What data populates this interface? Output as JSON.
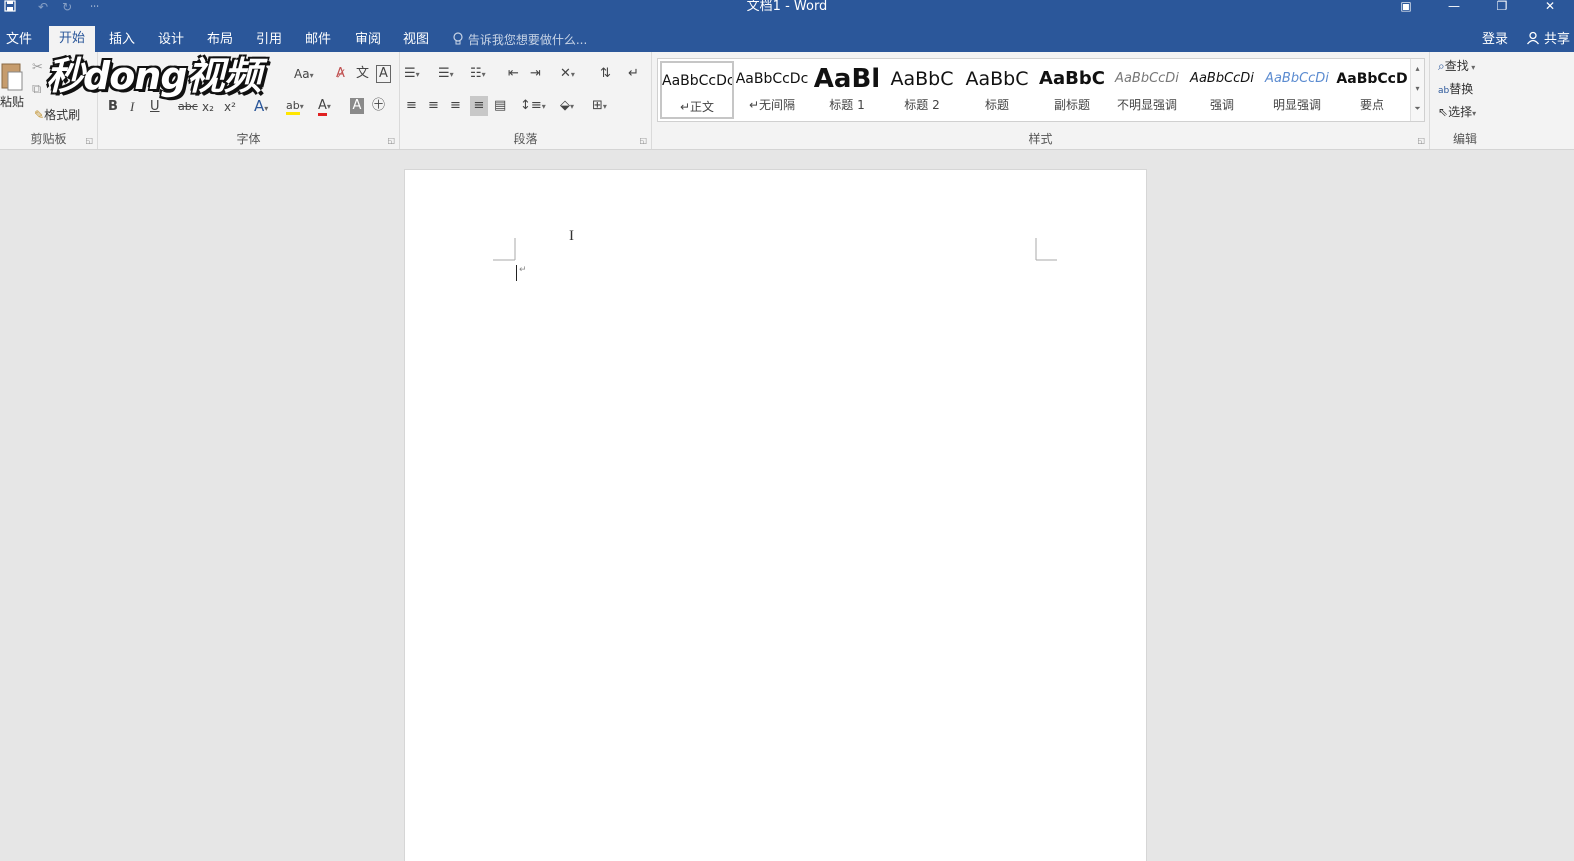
{
  "window": {
    "title": "文档1 - Word"
  },
  "qat": {
    "save_icon": "save-icon",
    "undo_icon": "undo-icon",
    "redo_icon": "redo-icon",
    "customize": "⋯"
  },
  "tabs": [
    {
      "label": "文件"
    },
    {
      "label": "开始"
    },
    {
      "label": "插入"
    },
    {
      "label": "设计"
    },
    {
      "label": "布局"
    },
    {
      "label": "引用"
    },
    {
      "label": "邮件"
    },
    {
      "label": "审阅"
    },
    {
      "label": "视图"
    }
  ],
  "tellme": {
    "placeholder": "告诉我您想要做什么..."
  },
  "account": {
    "login": "登录",
    "share": "共享"
  },
  "clipboard": {
    "paste": "粘贴",
    "format_painter": "格式刷",
    "label": "剪贴板"
  },
  "font": {
    "label": "字体",
    "change_case": "Aa",
    "bold": "B",
    "italic": "I",
    "underline": "U",
    "strike": "abc",
    "sub": "x₂",
    "sup": "x²",
    "font_color_glyph": "A",
    "highlight_glyph": "ab"
  },
  "paragraph": {
    "label": "段落"
  },
  "styles": {
    "label": "样式",
    "items": [
      {
        "sample": "AaBbCcDc",
        "name": "正文"
      },
      {
        "sample": "AaBbCcDc",
        "name": "无间隔"
      },
      {
        "sample": "AaBl",
        "name": "标题 1"
      },
      {
        "sample": "AaBbC",
        "name": "标题 2"
      },
      {
        "sample": "AaBbC",
        "name": "标题"
      },
      {
        "sample": "AaBbC",
        "name": "副标题"
      },
      {
        "sample": "AaBbCcDi",
        "name": "不明显强调"
      },
      {
        "sample": "AaBbCcDi",
        "name": "强调"
      },
      {
        "sample": "AaBbCcDi",
        "name": "明显强调"
      },
      {
        "sample": "AaBbCcD",
        "name": "要点"
      }
    ]
  },
  "editing": {
    "label": "编辑",
    "find": "查找",
    "replace": "替换",
    "select": "选择"
  },
  "watermark": {
    "text": "秒dong视频"
  },
  "colors": {
    "brand": "#2b579a",
    "ribbon": "#f3f3f3",
    "workspace": "#e6e6e6",
    "font_red": "#e02020",
    "highlight_yellow": "#ffe600"
  }
}
